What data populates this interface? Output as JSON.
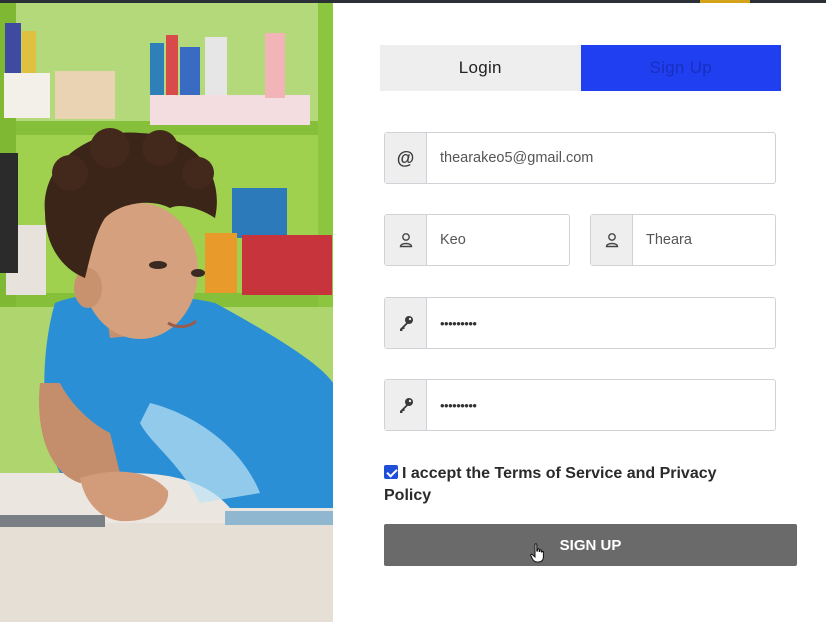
{
  "tabs": [
    {
      "label": "Login",
      "active": false
    },
    {
      "label": "Sign Up",
      "active": true
    }
  ],
  "form": {
    "email": {
      "icon": "at-sign-icon",
      "value": "thearakeo5@gmail.com"
    },
    "last_name": {
      "icon": "user-icon",
      "value": "Keo"
    },
    "first_name": {
      "icon": "user-icon",
      "value": "Theara"
    },
    "password": {
      "icon": "key-icon",
      "value": "•••••••••"
    },
    "confirm_password": {
      "icon": "key-icon",
      "value": "•••••••••"
    },
    "terms": {
      "checked": true,
      "label": "I accept the Terms of Service and Privacy Policy"
    },
    "submit_label": "SIGN UP"
  },
  "colors": {
    "active_tab": "#1f3ff0",
    "submit_button": "#6a6a6a",
    "checkbox": "#1f4fd8"
  }
}
